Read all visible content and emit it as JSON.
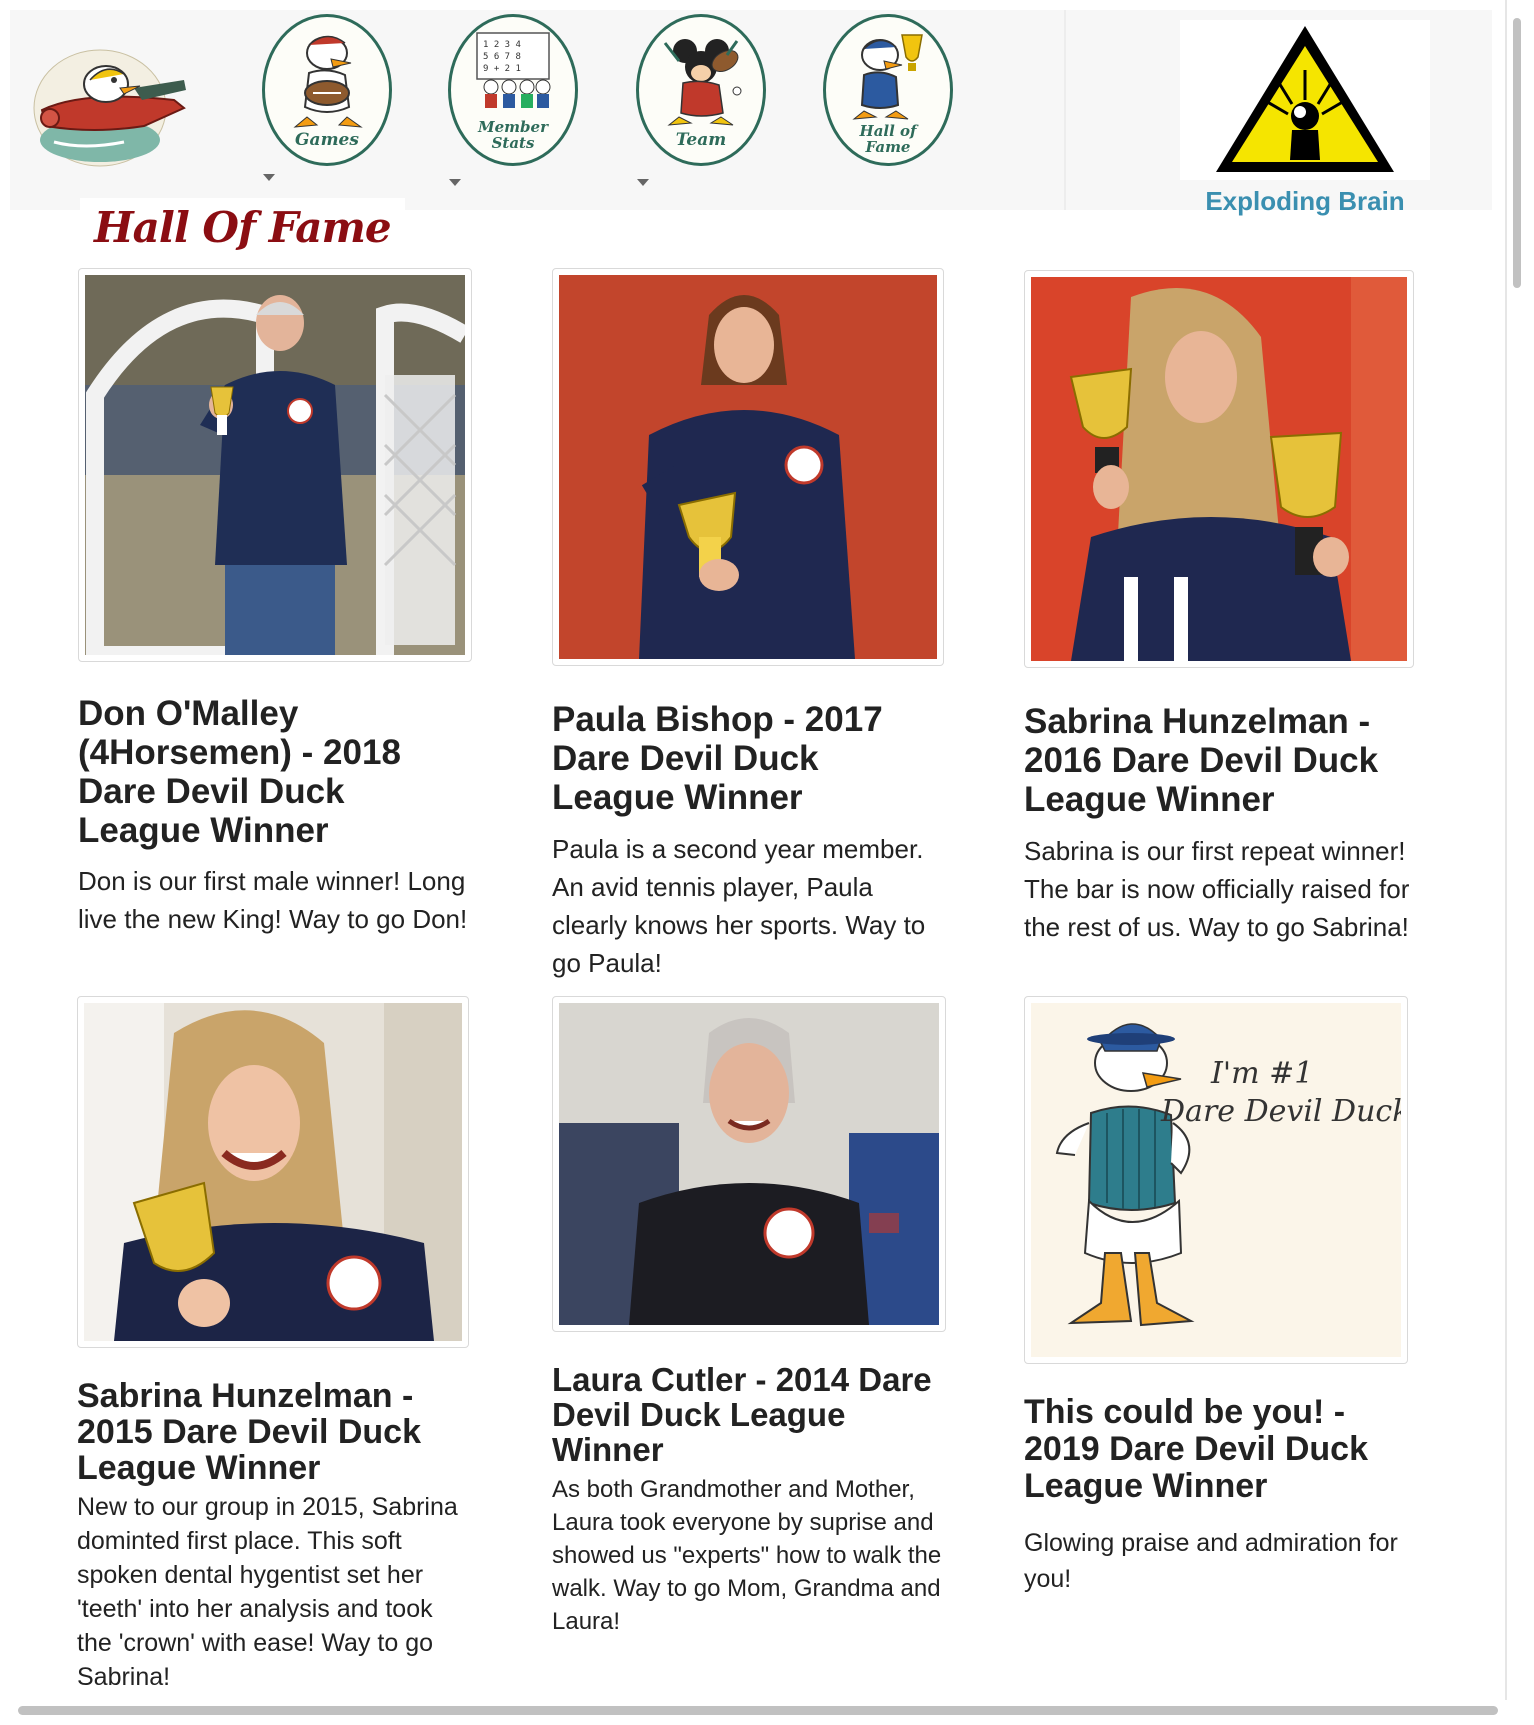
{
  "nav": {
    "items": [
      {
        "label": "",
        "icon": "plane-duck-logo-icon",
        "has_dropdown": false
      },
      {
        "label": "Games",
        "icon": "duck-football-icon",
        "has_dropdown": true
      },
      {
        "label": "Member Stats",
        "icon": "member-stats-icon",
        "has_dropdown": true
      },
      {
        "label": "Team",
        "icon": "team-mickey-icon",
        "has_dropdown": true
      },
      {
        "label": "Hall of Fame",
        "icon": "duck-trophy-icon",
        "has_dropdown": false
      }
    ],
    "exploding_brain": {
      "label": "Exploding Brain",
      "icon": "exploding-brain-warning-icon"
    }
  },
  "page": {
    "title": "Hall Of Fame"
  },
  "cards": [
    {
      "title": "Don O'Malley (4Horsemen) - 2018 Dare Devil Duck League Winner",
      "text": "Don is our first male winner! Long live the new King! Way to go Don!",
      "photo": "don-omalley-photo"
    },
    {
      "title": "Paula Bishop - 2017 Dare Devil Duck League Winner",
      "text": "Paula is a second year member. An avid tennis player, Paula clearly knows her sports. Way to go Paula!",
      "photo": "paula-bishop-photo"
    },
    {
      "title": "Sabrina Hunzelman - 2016 Dare Devil Duck League Winner",
      "text": "Sabrina is our first repeat winner! The bar is now officially raised for the rest of us. Way to go Sabrina!",
      "photo": "sabrina-2016-photo"
    },
    {
      "title": "Sabrina Hunzelman - 2015 Dare Devil Duck League Winner",
      "text": "New to our group in 2015, Sabrina dominted first place. This soft spoken dental hygentist set her 'teeth' into her analysis and took the 'crown' with ease! Way to go Sabrina!",
      "photo": "sabrina-2015-photo"
    },
    {
      "title": "Laura Cutler - 2014 Dare Devil Duck League Winner",
      "text": "As both Grandmother and Mother, Laura took everyone by suprise and showed us \"experts\" how to walk the walk. Way to go Mom, Grandma and Laura!",
      "photo": "laura-cutler-photo"
    },
    {
      "title": "This could be you! - 2019 Dare Devil Duck League Winner",
      "text": "Glowing praise and admiration for you!",
      "photo": "dare-devil-duck-illustration",
      "illustration_text": [
        "I'm #1",
        "Dare Devil Duck"
      ]
    }
  ],
  "colors": {
    "title": "#8b0d12",
    "badge_border": "#2e6b5a",
    "exploding_brain_label": "#3a8fb0",
    "warning_yellow": "#f5e500"
  }
}
